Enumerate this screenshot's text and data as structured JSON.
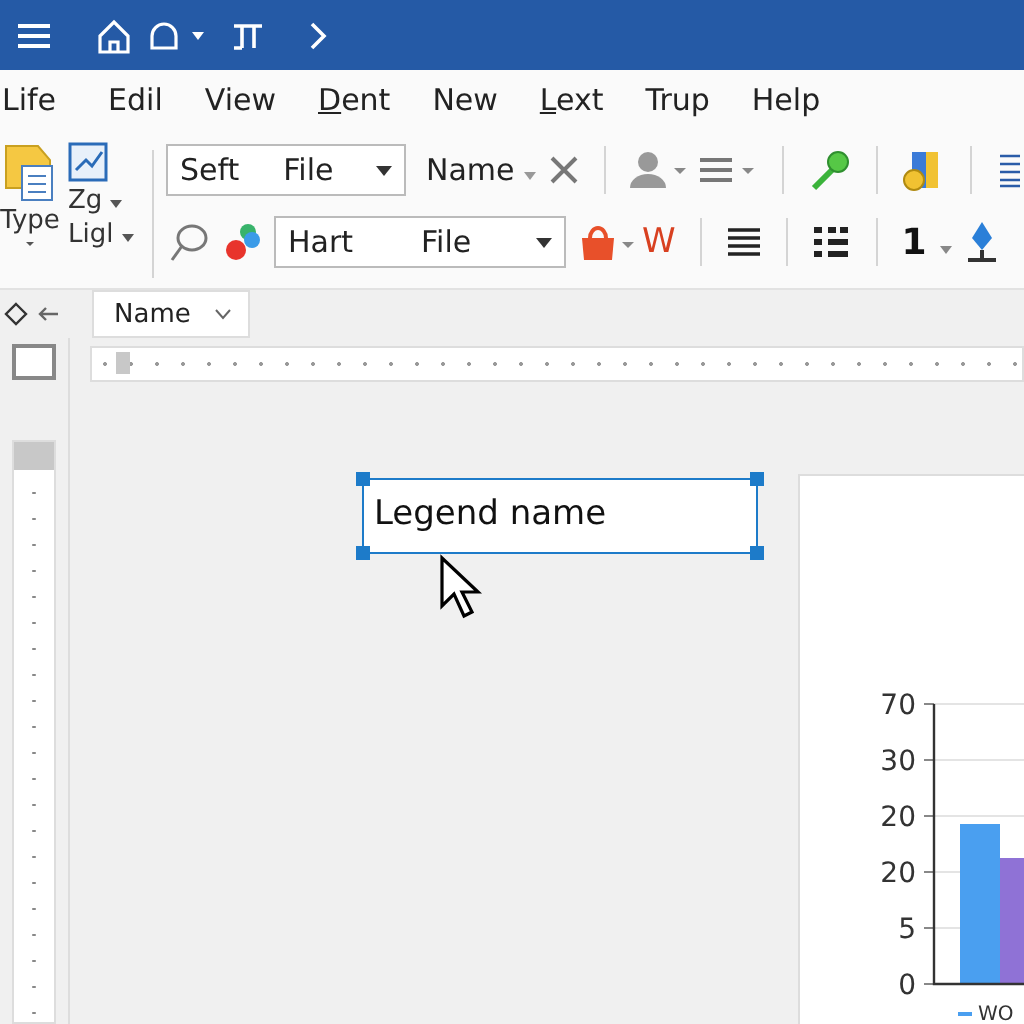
{
  "menu": [
    {
      "label": "Life",
      "underline_first": false
    },
    {
      "label": "Edil",
      "underline_first": false
    },
    {
      "label": "View",
      "underline_first": false
    },
    {
      "label": "Dent",
      "underline_first": true
    },
    {
      "label": "New",
      "underline_first": false
    },
    {
      "label": "Lext",
      "underline_first": true
    },
    {
      "label": "Trup",
      "underline_first": false
    },
    {
      "label": "Help",
      "underline_first": false
    }
  ],
  "toolbar": {
    "type_label": "Type",
    "zg_label": "Zg",
    "lig_label": "Ligl",
    "dropdown_1": [
      "Seft",
      "File"
    ],
    "name_label": "Name",
    "dropdown_2": [
      "Hart",
      "File"
    ],
    "w_label": "W",
    "number_label": "1"
  },
  "name_box": {
    "value": "Name"
  },
  "canvas": {
    "text_box": {
      "value": "Legend name"
    },
    "chart": {
      "y_axis_labels": [
        "70",
        "30",
        "20",
        "20",
        "5",
        "0"
      ],
      "legend": "WO"
    }
  }
}
